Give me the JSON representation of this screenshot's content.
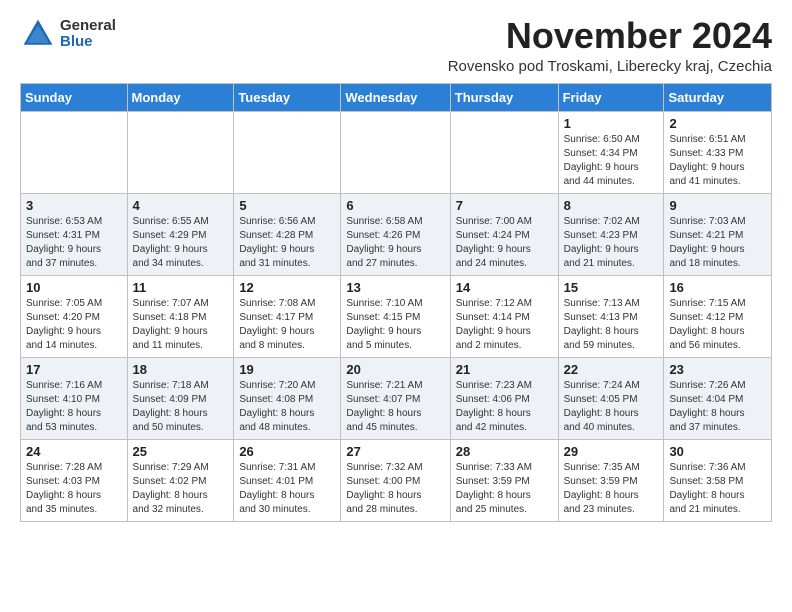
{
  "logo": {
    "general": "General",
    "blue": "Blue"
  },
  "title": "November 2024",
  "location": "Rovensko pod Troskami, Liberecky kraj, Czechia",
  "weekdays": [
    "Sunday",
    "Monday",
    "Tuesday",
    "Wednesday",
    "Thursday",
    "Friday",
    "Saturday"
  ],
  "weeks": [
    [
      {
        "day": "",
        "info": ""
      },
      {
        "day": "",
        "info": ""
      },
      {
        "day": "",
        "info": ""
      },
      {
        "day": "",
        "info": ""
      },
      {
        "day": "",
        "info": ""
      },
      {
        "day": "1",
        "info": "Sunrise: 6:50 AM\nSunset: 4:34 PM\nDaylight: 9 hours\nand 44 minutes."
      },
      {
        "day": "2",
        "info": "Sunrise: 6:51 AM\nSunset: 4:33 PM\nDaylight: 9 hours\nand 41 minutes."
      }
    ],
    [
      {
        "day": "3",
        "info": "Sunrise: 6:53 AM\nSunset: 4:31 PM\nDaylight: 9 hours\nand 37 minutes."
      },
      {
        "day": "4",
        "info": "Sunrise: 6:55 AM\nSunset: 4:29 PM\nDaylight: 9 hours\nand 34 minutes."
      },
      {
        "day": "5",
        "info": "Sunrise: 6:56 AM\nSunset: 4:28 PM\nDaylight: 9 hours\nand 31 minutes."
      },
      {
        "day": "6",
        "info": "Sunrise: 6:58 AM\nSunset: 4:26 PM\nDaylight: 9 hours\nand 27 minutes."
      },
      {
        "day": "7",
        "info": "Sunrise: 7:00 AM\nSunset: 4:24 PM\nDaylight: 9 hours\nand 24 minutes."
      },
      {
        "day": "8",
        "info": "Sunrise: 7:02 AM\nSunset: 4:23 PM\nDaylight: 9 hours\nand 21 minutes."
      },
      {
        "day": "9",
        "info": "Sunrise: 7:03 AM\nSunset: 4:21 PM\nDaylight: 9 hours\nand 18 minutes."
      }
    ],
    [
      {
        "day": "10",
        "info": "Sunrise: 7:05 AM\nSunset: 4:20 PM\nDaylight: 9 hours\nand 14 minutes."
      },
      {
        "day": "11",
        "info": "Sunrise: 7:07 AM\nSunset: 4:18 PM\nDaylight: 9 hours\nand 11 minutes."
      },
      {
        "day": "12",
        "info": "Sunrise: 7:08 AM\nSunset: 4:17 PM\nDaylight: 9 hours\nand 8 minutes."
      },
      {
        "day": "13",
        "info": "Sunrise: 7:10 AM\nSunset: 4:15 PM\nDaylight: 9 hours\nand 5 minutes."
      },
      {
        "day": "14",
        "info": "Sunrise: 7:12 AM\nSunset: 4:14 PM\nDaylight: 9 hours\nand 2 minutes."
      },
      {
        "day": "15",
        "info": "Sunrise: 7:13 AM\nSunset: 4:13 PM\nDaylight: 8 hours\nand 59 minutes."
      },
      {
        "day": "16",
        "info": "Sunrise: 7:15 AM\nSunset: 4:12 PM\nDaylight: 8 hours\nand 56 minutes."
      }
    ],
    [
      {
        "day": "17",
        "info": "Sunrise: 7:16 AM\nSunset: 4:10 PM\nDaylight: 8 hours\nand 53 minutes."
      },
      {
        "day": "18",
        "info": "Sunrise: 7:18 AM\nSunset: 4:09 PM\nDaylight: 8 hours\nand 50 minutes."
      },
      {
        "day": "19",
        "info": "Sunrise: 7:20 AM\nSunset: 4:08 PM\nDaylight: 8 hours\nand 48 minutes."
      },
      {
        "day": "20",
        "info": "Sunrise: 7:21 AM\nSunset: 4:07 PM\nDaylight: 8 hours\nand 45 minutes."
      },
      {
        "day": "21",
        "info": "Sunrise: 7:23 AM\nSunset: 4:06 PM\nDaylight: 8 hours\nand 42 minutes."
      },
      {
        "day": "22",
        "info": "Sunrise: 7:24 AM\nSunset: 4:05 PM\nDaylight: 8 hours\nand 40 minutes."
      },
      {
        "day": "23",
        "info": "Sunrise: 7:26 AM\nSunset: 4:04 PM\nDaylight: 8 hours\nand 37 minutes."
      }
    ],
    [
      {
        "day": "24",
        "info": "Sunrise: 7:28 AM\nSunset: 4:03 PM\nDaylight: 8 hours\nand 35 minutes."
      },
      {
        "day": "25",
        "info": "Sunrise: 7:29 AM\nSunset: 4:02 PM\nDaylight: 8 hours\nand 32 minutes."
      },
      {
        "day": "26",
        "info": "Sunrise: 7:31 AM\nSunset: 4:01 PM\nDaylight: 8 hours\nand 30 minutes."
      },
      {
        "day": "27",
        "info": "Sunrise: 7:32 AM\nSunset: 4:00 PM\nDaylight: 8 hours\nand 28 minutes."
      },
      {
        "day": "28",
        "info": "Sunrise: 7:33 AM\nSunset: 3:59 PM\nDaylight: 8 hours\nand 25 minutes."
      },
      {
        "day": "29",
        "info": "Sunrise: 7:35 AM\nSunset: 3:59 PM\nDaylight: 8 hours\nand 23 minutes."
      },
      {
        "day": "30",
        "info": "Sunrise: 7:36 AM\nSunset: 3:58 PM\nDaylight: 8 hours\nand 21 minutes."
      }
    ]
  ]
}
